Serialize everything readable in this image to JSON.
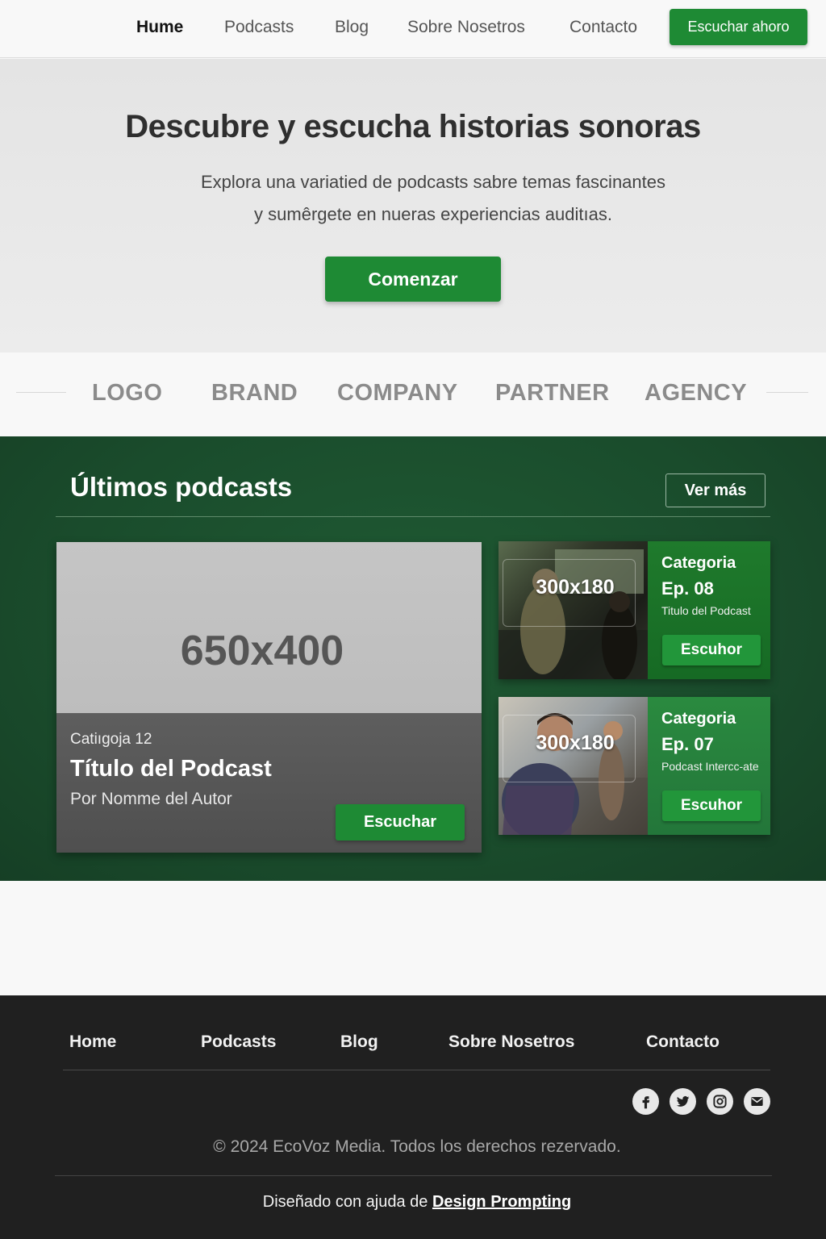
{
  "nav": {
    "links": [
      "Hume",
      "Podcasts",
      "Blog",
      "Sobre Nosetros",
      "Contacto"
    ],
    "cta": "Escuchar ahoro"
  },
  "hero": {
    "title": "Descubre y escucha historias sonoras",
    "subtitle_line1": "Explora una variatied de podcasts sabre temas fascinantes",
    "subtitle_line2": "y sumêrgete en nueras experiencias auditıas.",
    "button": "Comenzar"
  },
  "logos": [
    "LOGO",
    "BRAND",
    "COMPANY",
    "PARTNER",
    "AGENCY"
  ],
  "podcasts": {
    "title": "Últimos podcasts",
    "more": "Ver más",
    "featured": {
      "image_label": "650x400",
      "category": "Catiıgoja 12",
      "title": "Título del Podcast",
      "author": "Por Nomme del Autor",
      "button": "Escuchar"
    },
    "cards": [
      {
        "image_label": "300x180",
        "category": "Categoria",
        "episode": "Ep. 08",
        "subtitle": "Titulo del Podcast",
        "button": "Escuhor"
      },
      {
        "image_label": "300x180",
        "category": "Categoria",
        "episode": "Ep. 07",
        "subtitle": "Podcast Intercc-ate",
        "button": "Escuhor"
      }
    ]
  },
  "footer": {
    "links": [
      "Home",
      "Podcasts",
      "Blog",
      "Sobre Nosetros",
      "Contacto"
    ],
    "social_icons": [
      "facebook-icon",
      "twitter-icon",
      "instagram-icon",
      "email-icon"
    ],
    "copyright": "© 2024 EcoVoz Media. Todos los derechos rezervado.",
    "designed_prefix": "Diseñado con ajuda de",
    "designed_link": "Design Prompting"
  },
  "colors": {
    "accent_green": "#1e8a34",
    "section_green": "#1a4c2c",
    "footer_bg": "#202020"
  }
}
